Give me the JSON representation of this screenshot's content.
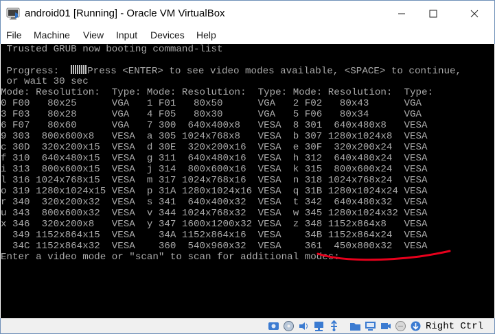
{
  "window": {
    "title": "android01 [Running] - Oracle VM VirtualBox"
  },
  "menu": [
    "File",
    "Machine",
    "View",
    "Input",
    "Devices",
    "Help"
  ],
  "console": {
    "line1": " Trusted GRUB now booting command-list",
    "progress_label": " Progress:  ",
    "progress_rest": "Press <ENTER> to see video modes available, <SPACE> to continue,",
    "line_wait": " or wait 30 sec",
    "header": "Mode: Resolution:  Type: Mode: Resolution:  Type: Mode: Resolution:  Type:",
    "modes": [
      "0 F00   80x25      VGA   1 F01   80x50      VGA   2 F02   80x43      VGA",
      "3 F03   80x28      VGA   4 F05   80x30      VGA   5 F06   80x34      VGA",
      "6 F07   80x60      VGA   7 300  640x400x8   VESA  8 301  640x480x8   VESA",
      "9 303  800x600x8   VESA  a 305 1024x768x8   VESA  b 307 1280x1024x8  VESA",
      "c 30D  320x200x15  VESA  d 30E  320x200x16  VESA  e 30F  320x200x24  VESA",
      "f 310  640x480x15  VESA  g 311  640x480x16  VESA  h 312  640x480x24  VESA",
      "i 313  800x600x15  VESA  j 314  800x600x16  VESA  k 315  800x600x24  VESA",
      "l 316 1024x768x15  VESA  m 317 1024x768x16  VESA  n 318 1024x768x24  VESA",
      "o 319 1280x1024x15 VESA  p 31A 1280x1024x16 VESA  q 31B 1280x1024x24 VESA",
      "r 340  320x200x32  VESA  s 341  640x400x32  VESA  t 342  640x480x32  VESA",
      "u 343  800x600x32  VESA  v 344 1024x768x32  VESA  w 345 1280x1024x32 VESA",
      "x 346  320x200x8   VESA  y 347 1600x1200x32 VESA  z 348 1152x864x8   VESA",
      "  349 1152x864x15  VESA    34A 1152x864x16  VESA    34B 1152x864x24  VESA",
      "  34C 1152x864x32  VESA    360  540x960x32  VESA    361  450x800x32  VESA"
    ],
    "prompt": "Enter a video mode or \"scan\" to scan for additional modes:"
  },
  "annotation": {
    "color": "#e8001c"
  },
  "statusbar": {
    "host_key": "Right Ctrl",
    "icons": [
      "hard-disk-icon",
      "optical-drive-icon",
      "audio-icon",
      "network-icon",
      "usb-icon",
      "shared-folder-icon",
      "display-icon",
      "recording-icon",
      "cpu-icon",
      "mouse-integration-icon",
      "keyboard-capture-icon"
    ]
  },
  "colors": {
    "console_bg": "#000000",
    "console_fg": "#aaaaaa",
    "frame": "#6e8fb8"
  }
}
